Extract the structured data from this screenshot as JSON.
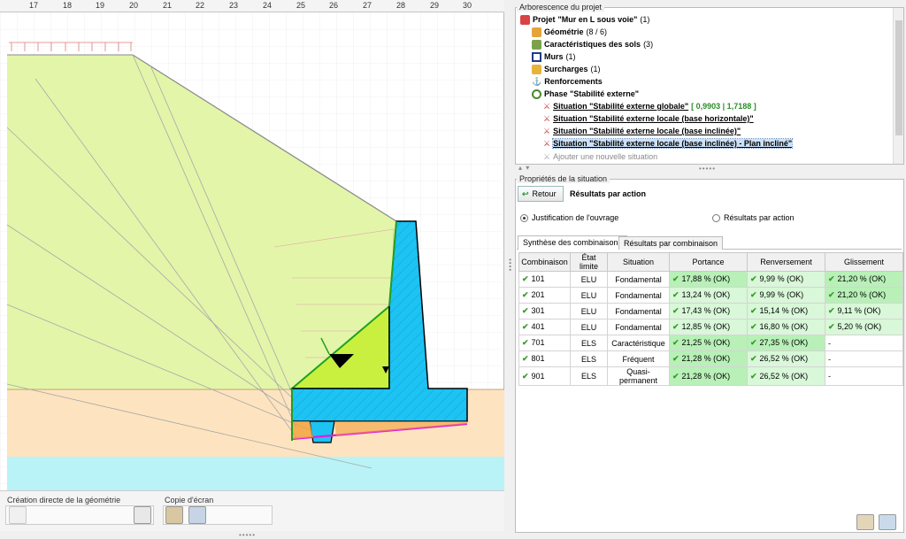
{
  "ruler": {
    "ticks": [
      "17",
      "18",
      "19",
      "20",
      "21",
      "22",
      "23",
      "24",
      "25",
      "26",
      "27",
      "28",
      "29",
      "30"
    ]
  },
  "toolbar": {
    "geometry_group_label": "Création directe de la géométrie",
    "screenshot_group_label": "Copie d'écran"
  },
  "tree": {
    "title": "Arborescence du projet",
    "project_prefix": "Projet ",
    "project_name": "\"Mur en L sous voie\"",
    "project_count": "(1)",
    "geometry_label": "Géométrie",
    "geometry_count": "(8 / 6)",
    "soils_label": "Caractéristiques des sols",
    "soils_count": "(3)",
    "walls_label": "Murs",
    "walls_count": "(1)",
    "surcharges_label": "Surcharges",
    "surcharges_count": "(1)",
    "reinforcements_label": "Renforcements",
    "phase_label": "Phase \"Stabilité externe\"",
    "situation1_label": "Situation \"Stabilité externe globale\"",
    "situation1_values": "[ 0,9903 | 1,7188 ]",
    "situation2_label": "Situation \"Stabilité externe locale (base horizontale)\"",
    "situation3_label": "Situation \"Stabilité externe locale (base inclinée)\"",
    "situation4_label": "Situation \"Stabilité externe locale (base inclinée) - Plan incliné\"",
    "add_situation_label": "Ajouter une nouvelle situation"
  },
  "props": {
    "title": "Propriétés de la situation",
    "back_label": "Retour",
    "results_heading": "Résultats par action",
    "radio_justification": "Justification de l'ouvrage",
    "radio_results": "Résultats par action",
    "tab_synthesis": "Synthèse des combinaisons",
    "tab_per_combination": "Résultats par combinaison"
  },
  "table": {
    "headers": [
      "Combinaison",
      "État limite",
      "Situation",
      "Portance",
      "Renversement",
      "Glissement"
    ],
    "rows": [
      [
        "101",
        "ELU",
        "Fondamental",
        "17,88 % (OK)",
        "9,99 % (OK)",
        "21,20 % (OK)"
      ],
      [
        "201",
        "ELU",
        "Fondamental",
        "13,24 % (OK)",
        "9,99 % (OK)",
        "21,20 % (OK)"
      ],
      [
        "301",
        "ELU",
        "Fondamental",
        "17,43 % (OK)",
        "15,14 % (OK)",
        "9,11 % (OK)"
      ],
      [
        "401",
        "ELU",
        "Fondamental",
        "12,85 % (OK)",
        "16,80 % (OK)",
        "5,20 % (OK)"
      ],
      [
        "701",
        "ELS",
        "Caractéristique",
        "21,25 % (OK)",
        "27,35 % (OK)",
        "-"
      ],
      [
        "801",
        "ELS",
        "Fréquent",
        "21,28 % (OK)",
        "26,52 % (OK)",
        "-"
      ],
      [
        "901",
        "ELS",
        "Quasi-permanent",
        "21,28 % (OK)",
        "26,52 % (OK)",
        "-"
      ]
    ]
  },
  "colors": {
    "soil_top": "#e3f5a9",
    "soil_mid": "#fde3bf",
    "soil_bottom": "#b9f3f7",
    "wall": "#1cc3f3",
    "wedge": "#c9f03f",
    "pass_strong": "#b8f0b8",
    "pass_light": "#d9f7d9"
  }
}
